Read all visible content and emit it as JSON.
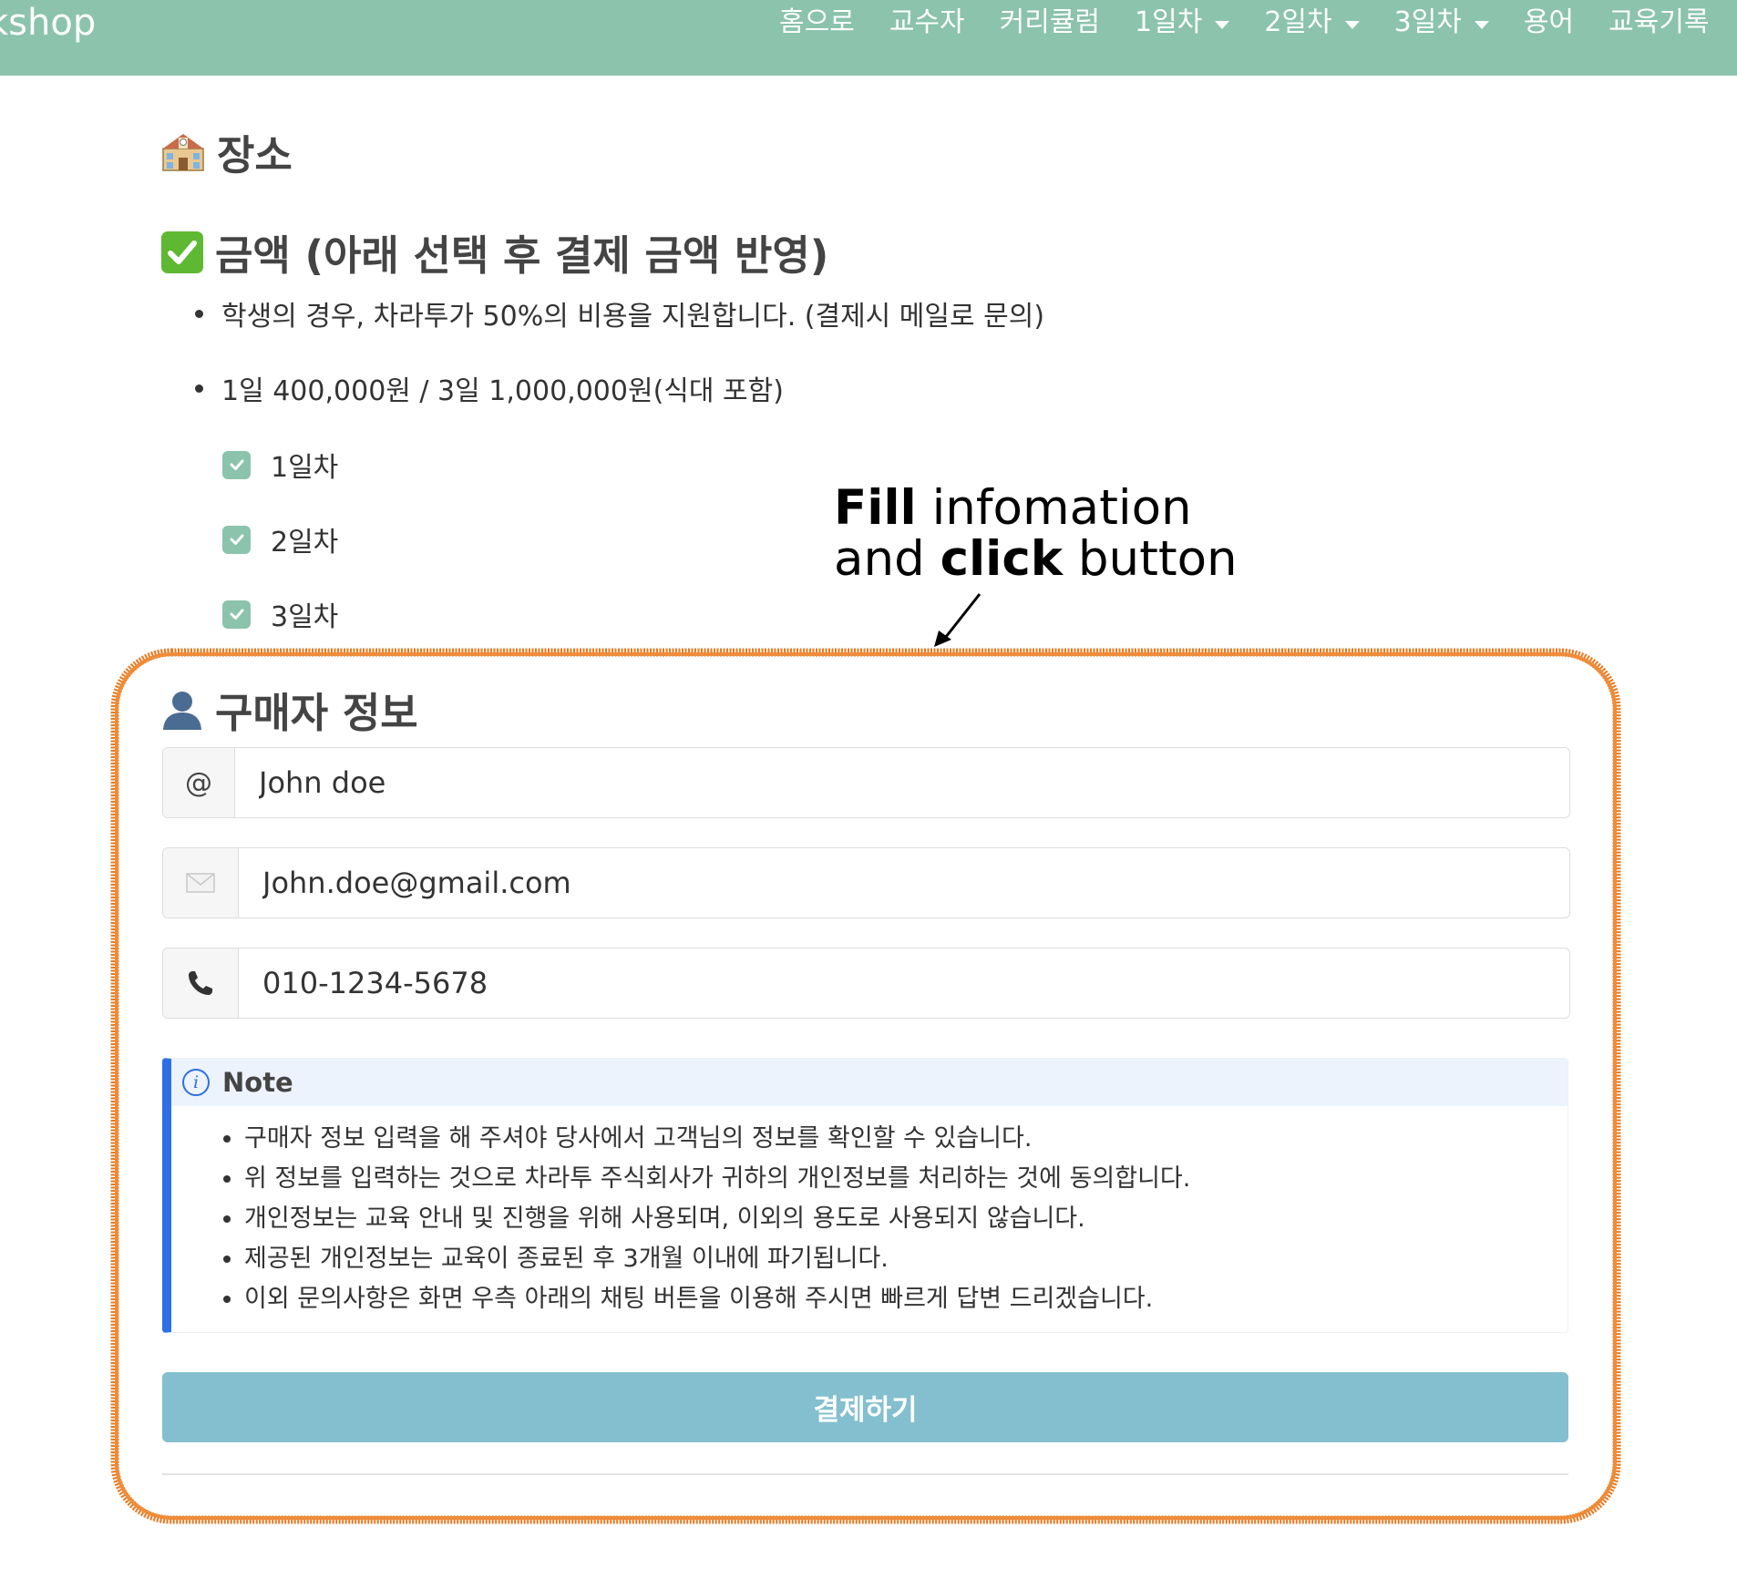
{
  "nav": {
    "brand": "kshop",
    "items": [
      {
        "label": "홈으로",
        "dropdown": false
      },
      {
        "label": "교수자",
        "dropdown": false
      },
      {
        "label": "커리큘럼",
        "dropdown": false
      },
      {
        "label": "1일차",
        "dropdown": true
      },
      {
        "label": "2일차",
        "dropdown": true
      },
      {
        "label": "3일차",
        "dropdown": true
      },
      {
        "label": "용어",
        "dropdown": false
      },
      {
        "label": "교육기록",
        "dropdown": false
      }
    ]
  },
  "location": {
    "title": "장소",
    "icon": "school-building-icon"
  },
  "price": {
    "title": "금액 (아래 선택 후 결제 금액 반영)",
    "icon": "check-mark-icon",
    "bullets": [
      "학생의 경우, 차라투가 50%의 비용을 지원합니다. (결제시 메일로 문의)",
      "1일 400,000원 / 3일 1,000,000원(식대 포함)"
    ],
    "options": [
      {
        "label": "1일차",
        "checked": true
      },
      {
        "label": "2일차",
        "checked": true
      },
      {
        "label": "3일차",
        "checked": true
      }
    ]
  },
  "annotation": {
    "line1_bold": "Fill",
    "line1_rest": " infomation",
    "line2_start": "and ",
    "line2_bold": "click",
    "line2_end": " button"
  },
  "buyer": {
    "title": "구매자 정보",
    "icon": "person-icon",
    "fields": [
      {
        "addon": "@",
        "value": "John doe"
      },
      {
        "addon": "envelope-icon",
        "value": "John.doe@gmail.com"
      },
      {
        "addon": "phone-icon",
        "value": "010-1234-5678"
      }
    ]
  },
  "note": {
    "title": "Note",
    "items": [
      "구매자 정보 입력을 해 주셔야 당사에서 고객님의 정보를 확인할 수 있습니다.",
      "위 정보를 입력하는 것으로 차라투 주식회사가 귀하의 개인정보를 처리하는 것에 동의합니다.",
      "개인정보는 교육 안내 및 진행을 위해 사용되며, 이외의 용도로 사용되지 않습니다.",
      "제공된 개인정보는 교육이 종료된 후 3개월 이내에 파기됩니다.",
      "이외 문의사항은 화면 우측 아래의 채팅 버튼을 이용해 주시면 빠르게 답변 드리겠습니다."
    ]
  },
  "pay_button": "결제하기",
  "colors": {
    "nav_bg": "#8bc3ad",
    "checkbox": "#8bc3ad",
    "pay_button": "#83bfcf",
    "note_accent": "#2e6fe6",
    "highlight_frame": "#e87a22"
  }
}
